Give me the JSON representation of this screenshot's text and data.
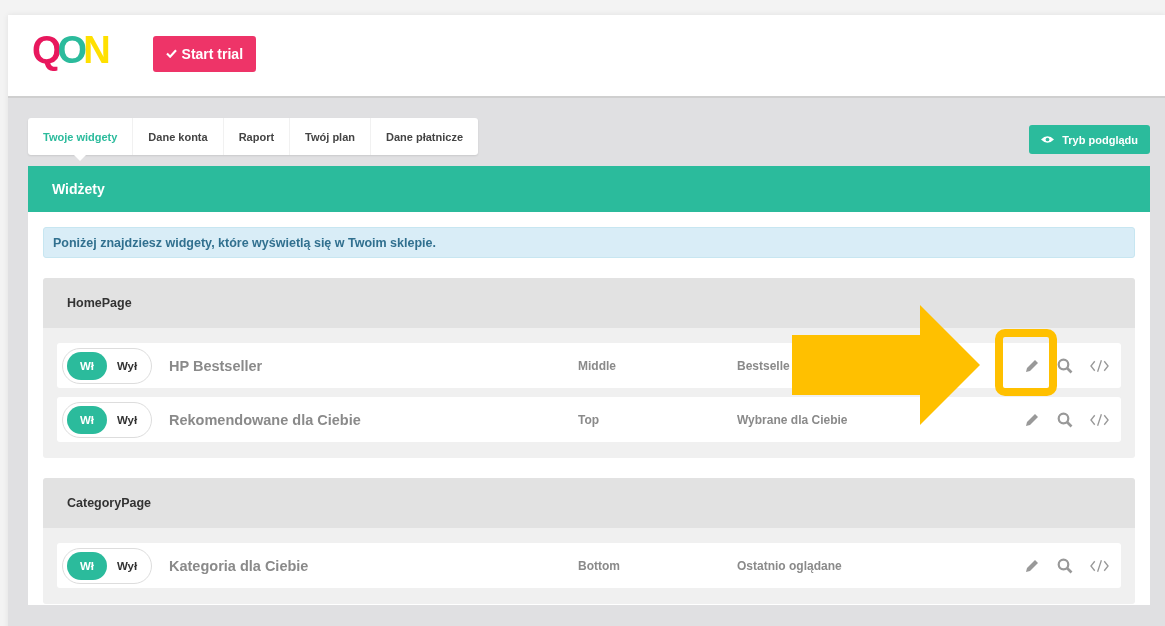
{
  "header": {
    "logo": "QON",
    "trial_button": "Start trial"
  },
  "tabs": [
    {
      "label": "Twoje widgety",
      "selected": true
    },
    {
      "label": "Dane konta",
      "selected": false
    },
    {
      "label": "Raport",
      "selected": false
    },
    {
      "label": "Twój plan",
      "selected": false
    },
    {
      "label": "Dane płatnicze",
      "selected": false
    }
  ],
  "preview_button": "Tryb podglądu",
  "panel": {
    "title": "Widżety",
    "info": "Poniżej znajdziesz widgety, które wyświetlą się w Twoim sklepie.",
    "sections": [
      {
        "title": "HomePage",
        "widgets": [
          {
            "on": true,
            "on_label": "Wł",
            "off_label": "Wył",
            "name": "HP Bestseller",
            "position": "Middle",
            "type": "Bestselle",
            "highlighted": true
          },
          {
            "on": true,
            "on_label": "Wł",
            "off_label": "Wył",
            "name": "Rekomendowane dla Ciebie",
            "position": "Top",
            "type": "Wybrane dla Ciebie",
            "highlighted": false
          }
        ]
      },
      {
        "title": "CategoryPage",
        "widgets": [
          {
            "on": true,
            "on_label": "Wł",
            "off_label": "Wył",
            "name": "Kategoria dla Ciebie",
            "position": "Bottom",
            "type": "Ostatnio oglądane",
            "highlighted": false
          }
        ]
      }
    ]
  }
}
